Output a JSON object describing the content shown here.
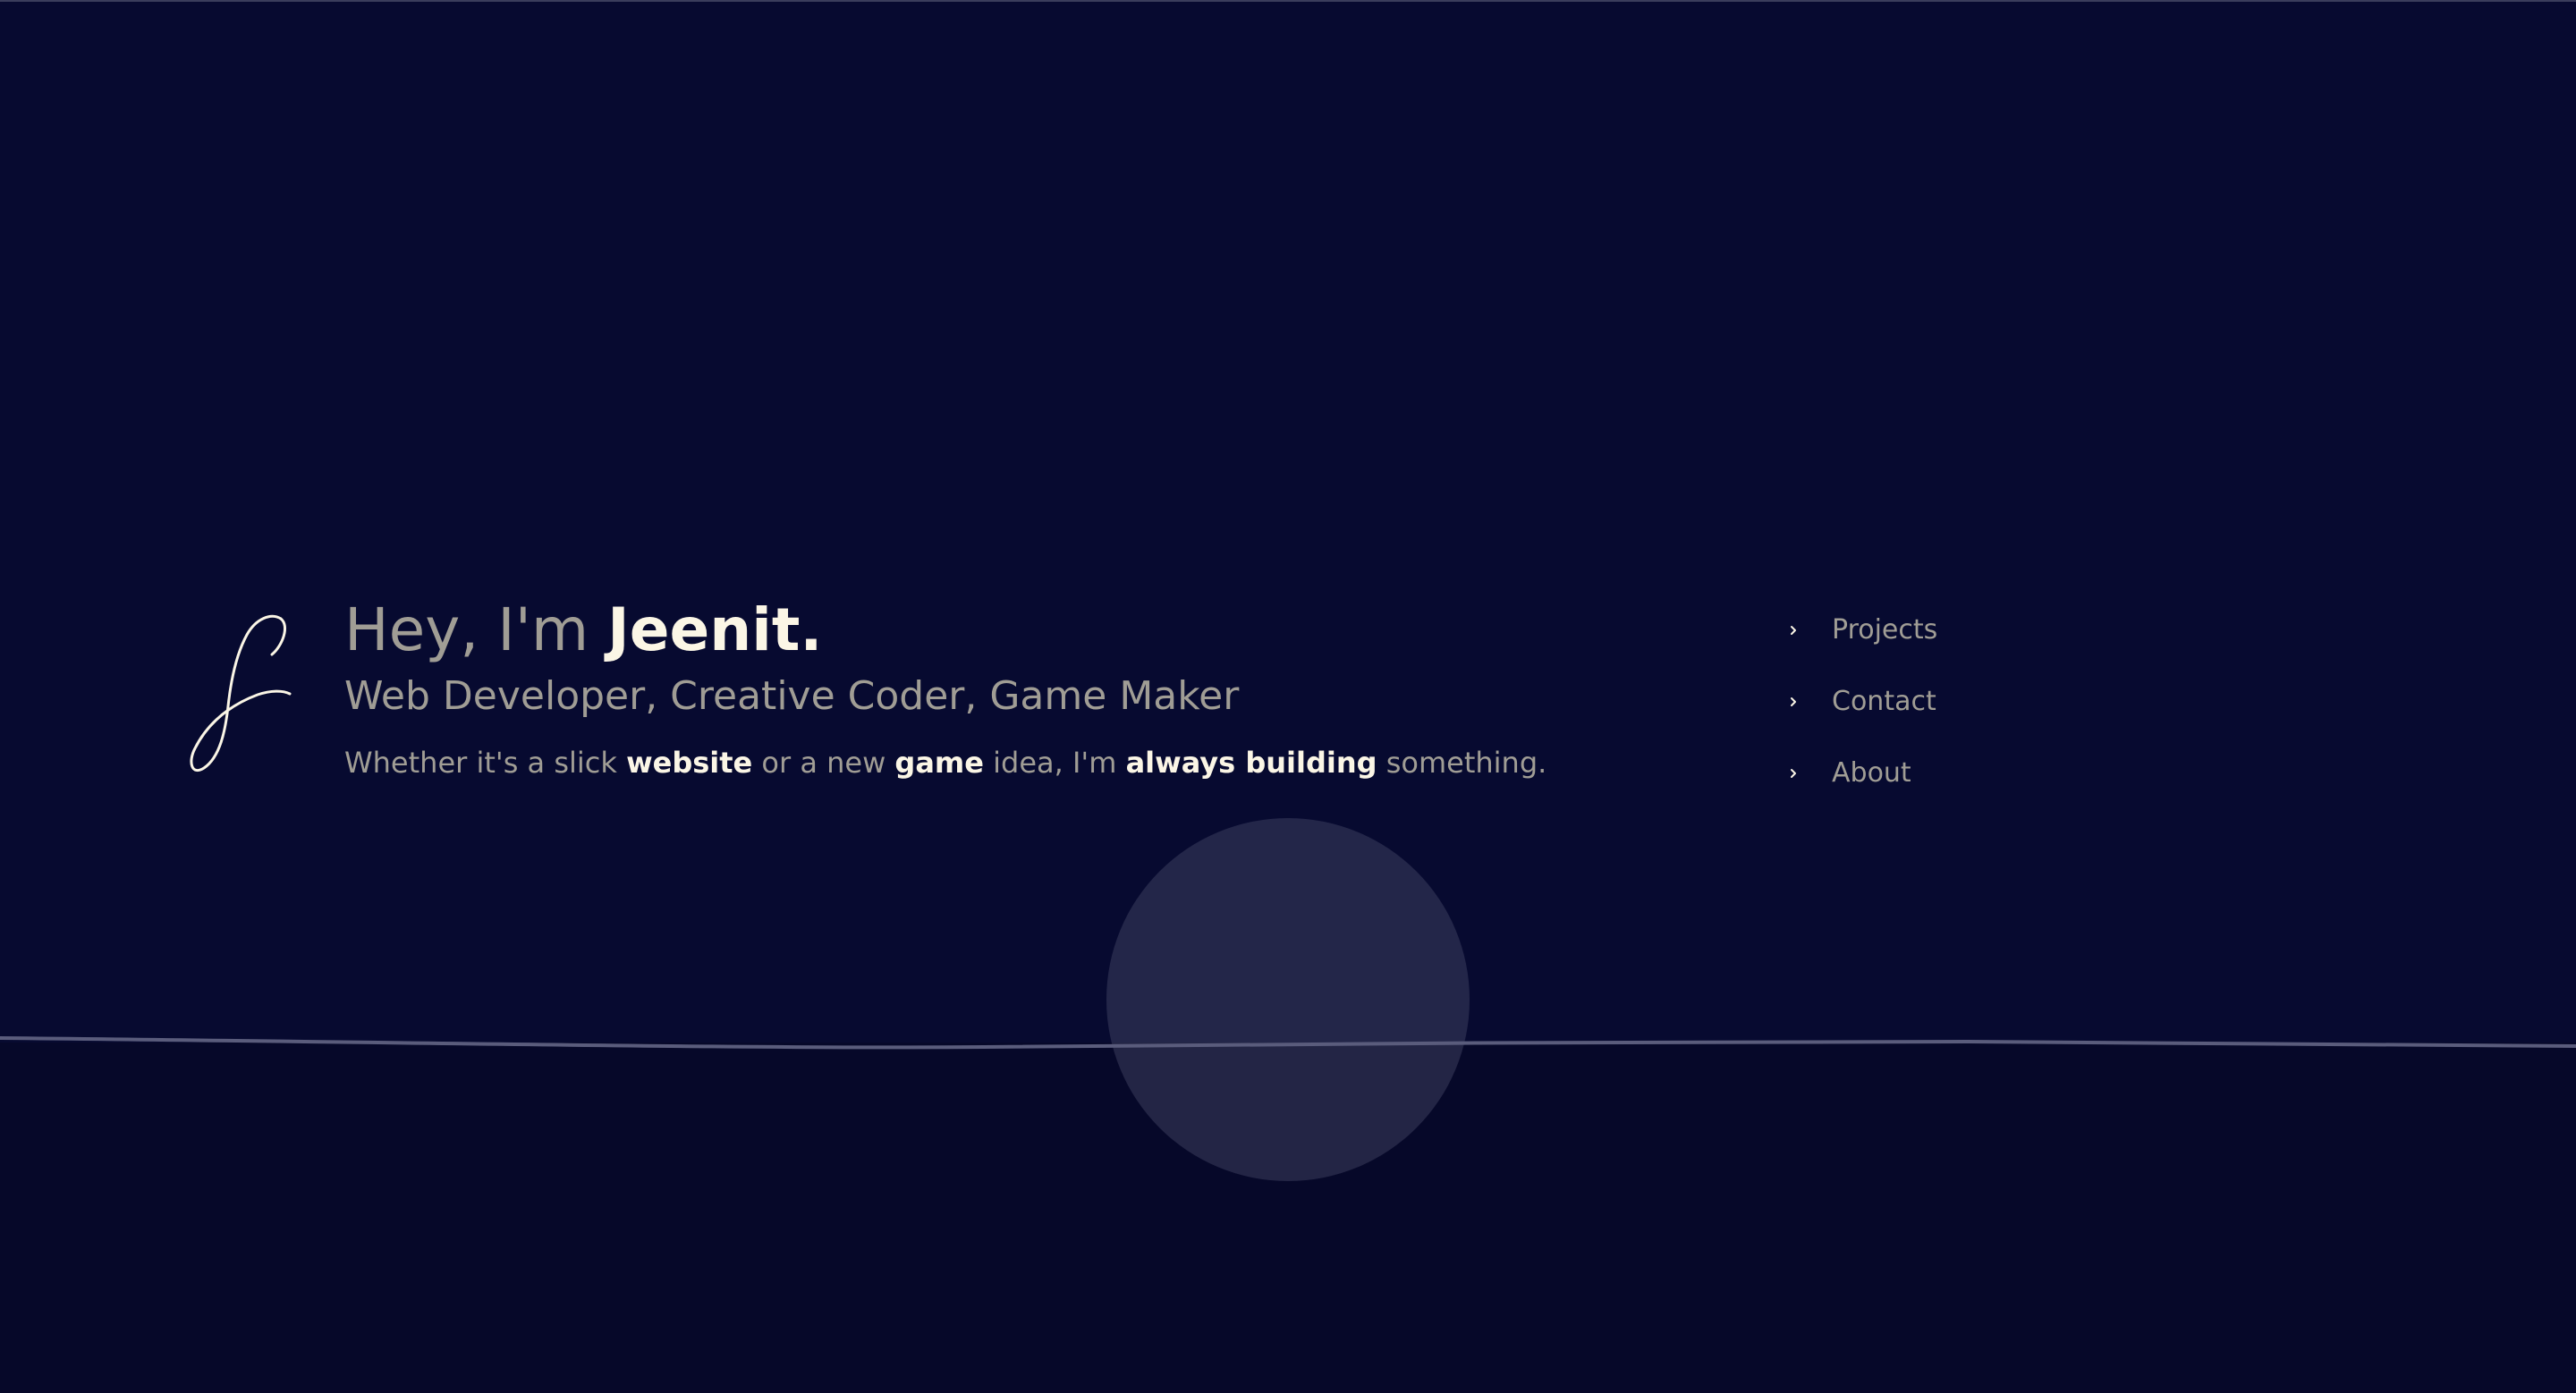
{
  "hero": {
    "greeting_prefix": "Hey, I'm ",
    "name": "Jeenit.",
    "roles": "Web Developer, Creative Coder, Game Maker",
    "tagline": {
      "part1": "Whether it's a slick ",
      "highlight1": "website",
      "part2": " or a new ",
      "highlight2": "game",
      "part3": " idea, I'm ",
      "highlight3": "always building",
      "part4": " something."
    }
  },
  "signature": {
    "icon": "signature-j-icon",
    "letter": "J"
  },
  "nav": {
    "items": [
      {
        "label": "Projects",
        "icon": "chevron-right-icon"
      },
      {
        "label": "Contact",
        "icon": "chevron-right-icon"
      },
      {
        "label": "About",
        "icon": "chevron-right-icon"
      }
    ]
  },
  "colors": {
    "background": "#070a30",
    "background_lower": "#060829",
    "text_muted": "#a09d95",
    "text_highlight": "#fbf6e6",
    "horizon_line": "#5a5c7c",
    "orb": "#2e3050"
  }
}
